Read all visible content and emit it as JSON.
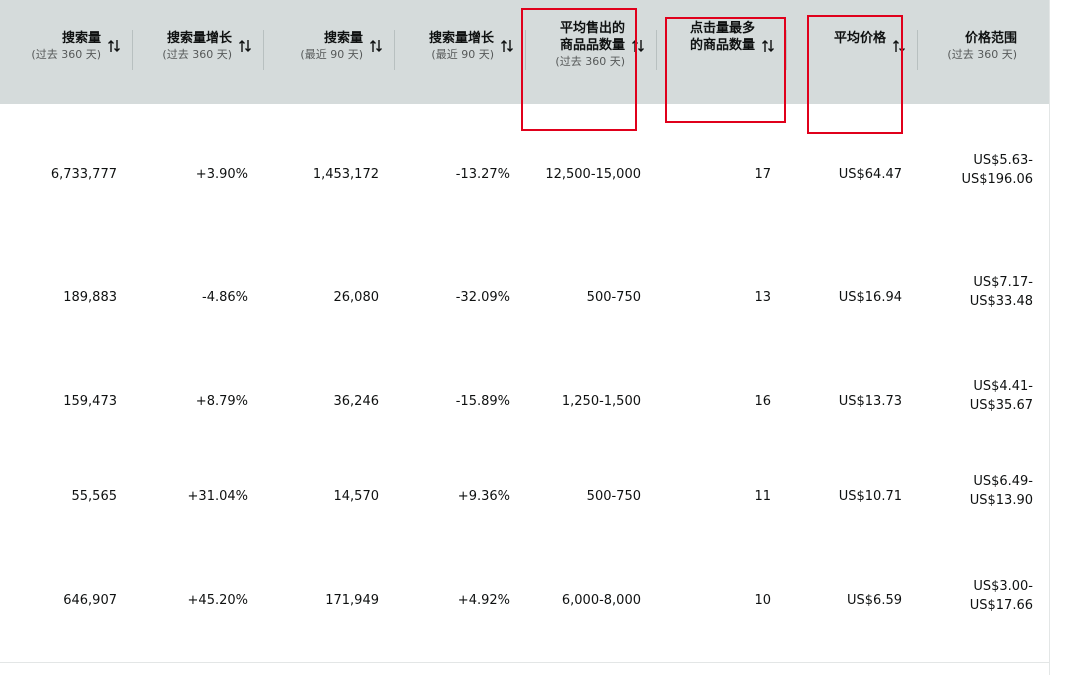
{
  "columns": [
    {
      "key": "search_volume_360",
      "title": "搜索量",
      "title2": "",
      "subtitle": "(过去 360 天)"
    },
    {
      "key": "search_growth_360",
      "title": "搜索量增长",
      "title2": "",
      "subtitle": "(过去 360 天)"
    },
    {
      "key": "search_volume_90",
      "title": "搜索量",
      "title2": "",
      "subtitle": "(最近 90 天)"
    },
    {
      "key": "search_growth_90",
      "title": "搜索量增长",
      "title2": "",
      "subtitle": "(最近 90 天)"
    },
    {
      "key": "avg_units_sold",
      "title": "平均售出的",
      "title2": "商品品数量",
      "subtitle": "(过去 360 天)"
    },
    {
      "key": "top_clicked_count",
      "title": "点击量最多",
      "title2": "的商品数量",
      "subtitle": ""
    },
    {
      "key": "avg_price",
      "title": "平均价格",
      "title2": "",
      "subtitle": ""
    },
    {
      "key": "price_range",
      "title": "价格范围",
      "title2": "",
      "subtitle": "(过去 360 天)"
    }
  ],
  "rows": [
    {
      "search_volume_360": "6,733,777",
      "search_growth_360": "+3.90%",
      "search_volume_90": "1,453,172",
      "search_growth_90": "-13.27%",
      "avg_units_sold": "12,500-15,000",
      "top_clicked_count": "17",
      "avg_price": "US$64.47",
      "price_low": "US$5.63-",
      "price_high": "US$196.06"
    },
    {
      "search_volume_360": "189,883",
      "search_growth_360": "-4.86%",
      "search_volume_90": "26,080",
      "search_growth_90": "-32.09%",
      "avg_units_sold": "500-750",
      "top_clicked_count": "13",
      "avg_price": "US$16.94",
      "price_low": "US$7.17-",
      "price_high": "US$33.48"
    },
    {
      "search_volume_360": "159,473",
      "search_growth_360": "+8.79%",
      "search_volume_90": "36,246",
      "search_growth_90": "-15.89%",
      "avg_units_sold": "1,250-1,500",
      "top_clicked_count": "16",
      "avg_price": "US$13.73",
      "price_low": "US$4.41-",
      "price_high": "US$35.67"
    },
    {
      "search_volume_360": "55,565",
      "search_growth_360": "+31.04%",
      "search_volume_90": "14,570",
      "search_growth_90": "+9.36%",
      "avg_units_sold": "500-750",
      "top_clicked_count": "11",
      "avg_price": "US$10.71",
      "price_low": "US$6.49-",
      "price_high": "US$13.90"
    },
    {
      "search_volume_360": "646,907",
      "search_growth_360": "+45.20%",
      "search_volume_90": "171,949",
      "search_growth_90": "+4.92%",
      "avg_units_sold": "6,000-8,000",
      "top_clicked_count": "10",
      "avg_price": "US$6.59",
      "price_low": "US$3.00-",
      "price_high": "US$17.66"
    }
  ],
  "colors": {
    "header_bg": "#d5dbdb",
    "highlight": "#e0001b",
    "text": "#0f1111",
    "subtext": "#565959"
  },
  "icons": {
    "sort": "sort-arrows-icon"
  }
}
